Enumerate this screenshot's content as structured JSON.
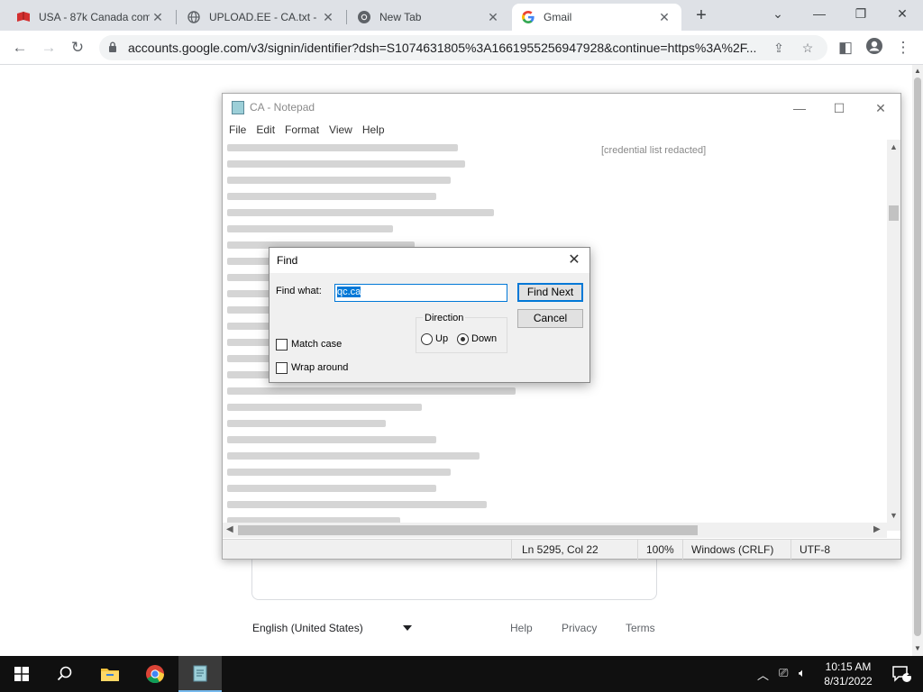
{
  "browser": {
    "tabs": [
      {
        "title": "USA - 87k Canada com",
        "favicon": "red-book-icon",
        "active": false
      },
      {
        "title": "UPLOAD.EE - CA.txt - D",
        "favicon": "globe-icon",
        "active": false
      },
      {
        "title": "New Tab",
        "favicon": "chrome-icon",
        "active": false
      },
      {
        "title": "Gmail",
        "favicon": "google-g-icon",
        "active": true
      }
    ],
    "url": "accounts.google.com/v3/signin/identifier?dsh=S1074631805%3A1661955256947928&continue=https%3A%2F..."
  },
  "google_page": {
    "language": "English (United States)",
    "links": [
      "Help",
      "Privacy",
      "Terms"
    ]
  },
  "notepad": {
    "title": "CA - Notepad",
    "menu": [
      "File",
      "Edit",
      "Format",
      "View",
      "Help"
    ],
    "content_note": "[credential list redacted]",
    "status": {
      "position": "Ln 5295, Col 22",
      "zoom": "100%",
      "line_ending": "Windows (CRLF)",
      "encoding": "UTF-8"
    }
  },
  "find_dialog": {
    "title": "Find",
    "find_what_label": "Find what:",
    "find_what_value": "qc.ca",
    "find_next_label": "Find Next",
    "cancel_label": "Cancel",
    "direction_label": "Direction",
    "up_label": "Up",
    "down_label": "Down",
    "selected_direction": "down",
    "match_case_label": "Match case",
    "match_case_checked": false,
    "wrap_around_label": "Wrap around",
    "wrap_around_checked": false
  },
  "taskbar": {
    "time": "10:15 AM",
    "date": "8/31/2022",
    "notification_count": "1"
  }
}
